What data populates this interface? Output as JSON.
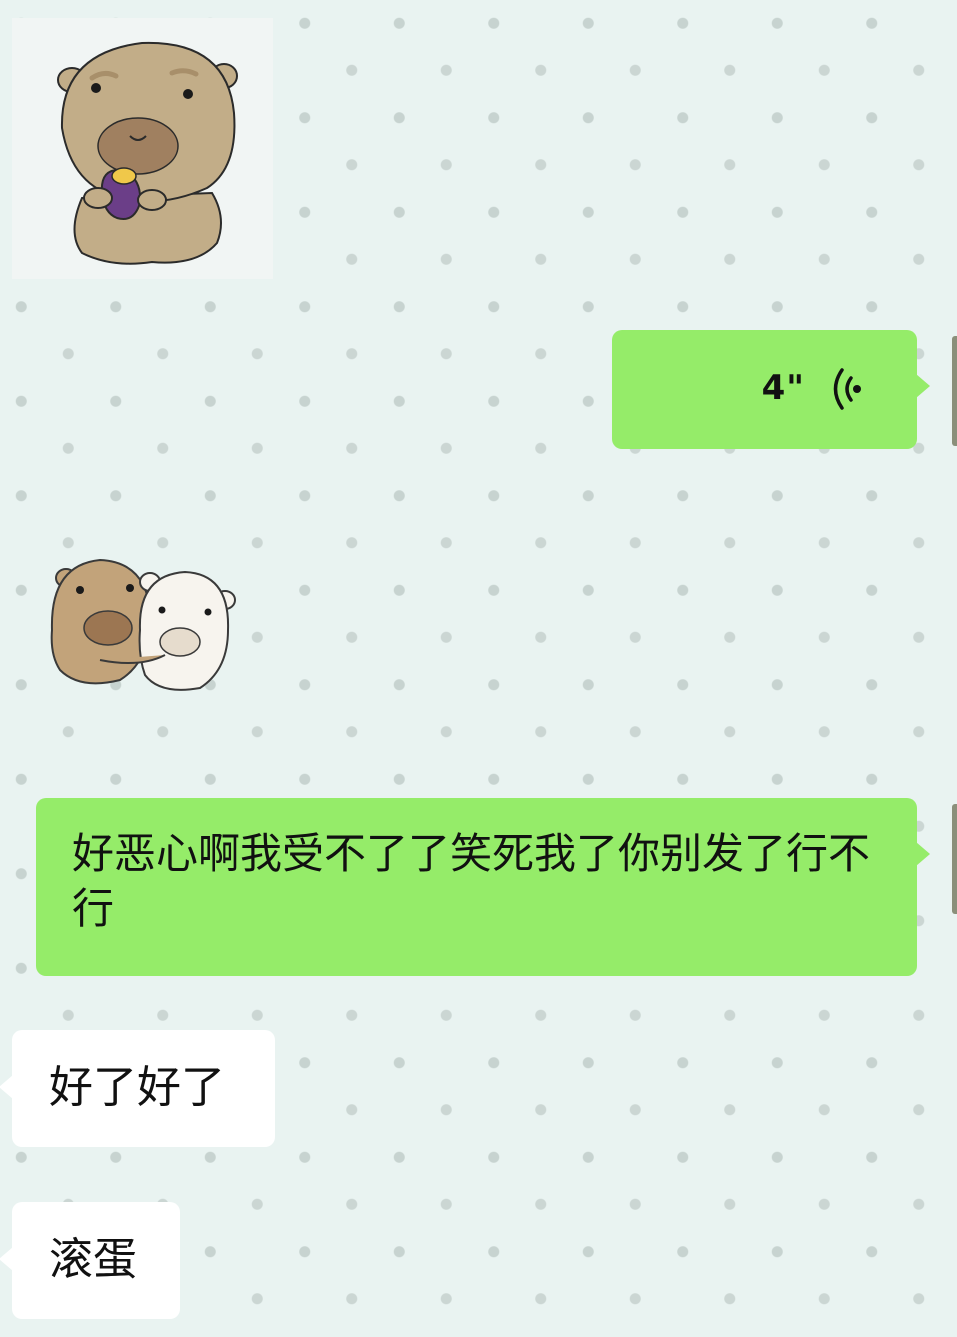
{
  "chat": {
    "colors": {
      "background": "#e9f3f1",
      "sent_bubble": "#95ec69",
      "received_bubble": "#ffffff"
    },
    "messages": [
      {
        "type": "sticker",
        "side": "left",
        "icon": "capybara-eating-sweet-potato-sticker"
      },
      {
        "type": "voice",
        "side": "right",
        "duration": "4\"",
        "icon": "voice-wave-icon"
      },
      {
        "type": "sticker",
        "side": "left",
        "icon": "capybara-hugging-friend-sticker"
      },
      {
        "type": "text",
        "side": "right",
        "text": "好恶心啊我受不了了笑死我了你别发了行不行"
      },
      {
        "type": "text",
        "side": "left",
        "text": "好了好了"
      },
      {
        "type": "text",
        "side": "left",
        "text": "滚蛋"
      }
    ]
  }
}
